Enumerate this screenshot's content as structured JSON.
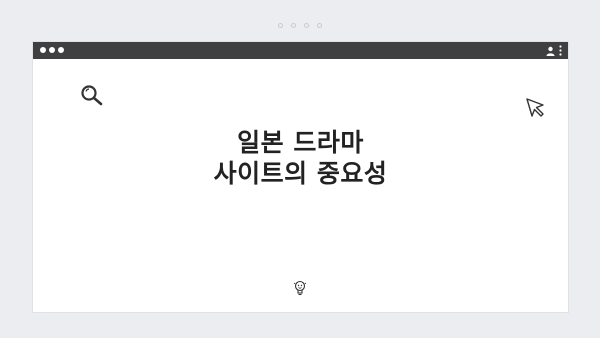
{
  "window": {
    "title_lines": [
      "일본 드라마",
      "사이트의 중요성"
    ]
  },
  "icons": {
    "top_dots": "pagination-dots-icon",
    "window_controls": "window-dots-icon",
    "user": "user-icon",
    "menu": "kebab-menu-icon",
    "search": "search-icon",
    "cursor": "cursor-icon",
    "bulb": "lightbulb-icon"
  },
  "colors": {
    "background": "#ecedf0",
    "titlebar": "#3f3f41",
    "text": "#222222"
  }
}
